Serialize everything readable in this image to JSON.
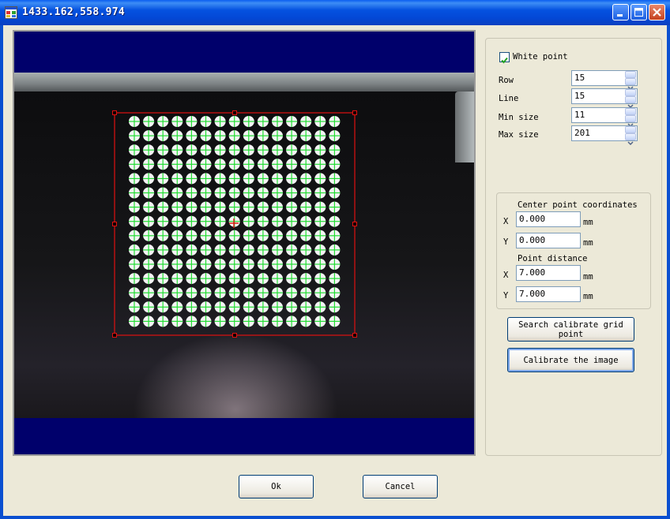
{
  "window": {
    "title": "1433.162,558.974"
  },
  "viewer": {
    "grid_rows": 15,
    "grid_cols": 15
  },
  "settings": {
    "white_point": {
      "label": "White point",
      "checked": true
    },
    "row": {
      "label": "Row",
      "value": "15"
    },
    "line": {
      "label": "Line",
      "value": "15"
    },
    "min_size": {
      "label": "Min size",
      "value": "11"
    },
    "max_size": {
      "label": "Max size",
      "value": "201"
    }
  },
  "coords": {
    "center_title": "Center point coordinates",
    "center_x": {
      "label": "X",
      "value": "0.000",
      "unit": "mm"
    },
    "center_y": {
      "label": "Y",
      "value": "0.000",
      "unit": "mm"
    },
    "distance_title": "Point distance",
    "dist_x": {
      "label": "X",
      "value": "7.000",
      "unit": "mm"
    },
    "dist_y": {
      "label": "Y",
      "value": "7.000",
      "unit": "mm"
    }
  },
  "buttons": {
    "search": "Search calibrate grid point",
    "calibrate": "Calibrate the image",
    "ok": "Ok",
    "cancel": "Cancel"
  },
  "colors": {
    "title_bar": "#0a5ef0",
    "overlay_red": "#e01010",
    "dot_green": "#22dd33"
  }
}
